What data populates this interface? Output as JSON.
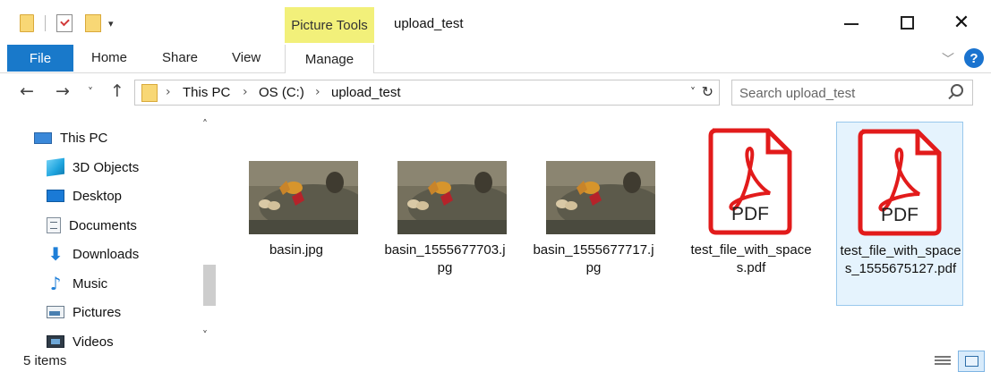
{
  "window": {
    "title": "upload_test",
    "contextual_tab_group": "Picture Tools",
    "controls": {
      "minimize": "—",
      "maximize": "☐",
      "close": "✕"
    }
  },
  "quick_access": {
    "dropdown_glyph": "▾"
  },
  "ribbon": {
    "tabs": [
      "File",
      "Home",
      "Share",
      "View"
    ],
    "contextual_tab": "Manage",
    "chevron": "﹀",
    "help": "?"
  },
  "navigation": {
    "back_glyph": "←",
    "forward_glyph": "→",
    "recent_glyph": "˅",
    "up_glyph": "↑",
    "breadcrumbs": [
      "This PC",
      "OS (C:)",
      "upload_test"
    ],
    "crumb_separator": "›",
    "address_dropdown": "˅",
    "refresh_glyph": "↻",
    "search_placeholder": "Search upload_test"
  },
  "nav_pane": {
    "items": [
      {
        "label": "This PC",
        "icon": "computer-icon"
      },
      {
        "label": "3D Objects",
        "icon": "3d-objects-icon"
      },
      {
        "label": "Desktop",
        "icon": "desktop-icon"
      },
      {
        "label": "Documents",
        "icon": "documents-icon"
      },
      {
        "label": "Downloads",
        "icon": "downloads-icon"
      },
      {
        "label": "Music",
        "icon": "music-icon"
      },
      {
        "label": "Pictures",
        "icon": "pictures-icon"
      },
      {
        "label": "Videos",
        "icon": "videos-icon"
      }
    ],
    "scroll_up": "˄",
    "scroll_down": "˅"
  },
  "files": [
    {
      "name": "basin.jpg",
      "type": "image",
      "selected": false
    },
    {
      "name": "basin_1555677703.jpg",
      "type": "image",
      "selected": false
    },
    {
      "name": "basin_1555677717.jpg",
      "type": "image",
      "selected": false
    },
    {
      "name": "test_file_with_spaces.pdf",
      "type": "pdf",
      "selected": false,
      "badge": "PDF"
    },
    {
      "name": "test_file_with_spaces_1555675127.pdf",
      "type": "pdf",
      "selected": true,
      "badge": "PDF"
    }
  ],
  "status": {
    "item_count": "5 items"
  },
  "colors": {
    "file_tab": "#1979ca",
    "picture_tools": "#f2f07a",
    "pdf_red": "#e21b1b",
    "selection": "#e5f3fd"
  }
}
